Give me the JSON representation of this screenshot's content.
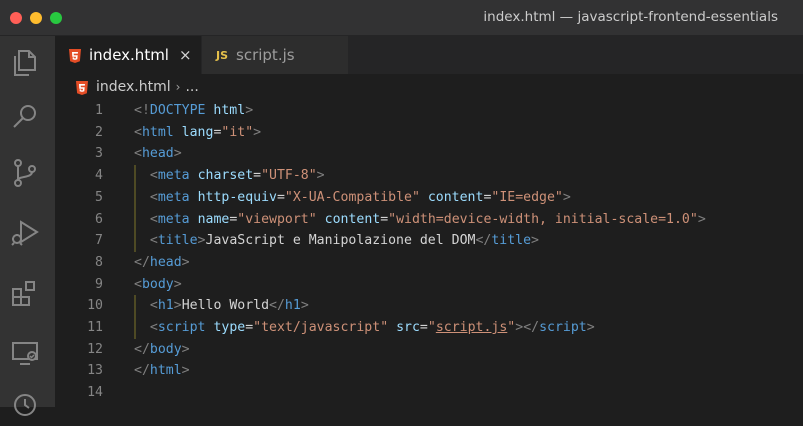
{
  "window": {
    "title": "index.html — javascript-frontend-essentials"
  },
  "activity_bar": {
    "icons": [
      "files-icon",
      "search-icon",
      "source-control-icon",
      "run-debug-icon",
      "extensions-icon",
      "remote-explorer-icon",
      "timeline-icon"
    ]
  },
  "tabs": [
    {
      "label": "index.html",
      "icon": "html5-icon",
      "active": true,
      "close": "×"
    },
    {
      "label": "script.js",
      "icon": "js-icon",
      "badge": "JS",
      "active": false
    }
  ],
  "breadcrumb": {
    "file": "index.html",
    "separator": "›",
    "rest": "..."
  },
  "colors": {
    "tag": "#569cd6",
    "punctuation": "#808080",
    "attribute": "#9cdcfe",
    "string": "#ce9178",
    "text": "#d4d4d4",
    "line_number": "#858585",
    "indent_guide": "#4e4a24"
  },
  "editor": {
    "lines": [
      {
        "n": "1",
        "tokens": [
          [
            "ang",
            "<!"
          ],
          [
            "tag",
            "DOCTYPE"
          ],
          [
            "txt",
            " "
          ],
          [
            "attr",
            "html"
          ],
          [
            "ang",
            ">"
          ]
        ]
      },
      {
        "n": "2",
        "tokens": [
          [
            "ang",
            "<"
          ],
          [
            "tag",
            "html"
          ],
          [
            "txt",
            " "
          ],
          [
            "attr",
            "lang"
          ],
          [
            "txt",
            "="
          ],
          [
            "str",
            "\"it\""
          ],
          [
            "ang",
            ">"
          ]
        ]
      },
      {
        "n": "3",
        "tokens": [
          [
            "ang",
            "<"
          ],
          [
            "tag",
            "head"
          ],
          [
            "ang",
            ">"
          ]
        ]
      },
      {
        "n": "4",
        "tokens": [
          [
            "txt",
            "  "
          ],
          [
            "ang",
            "<"
          ],
          [
            "tag",
            "meta"
          ],
          [
            "txt",
            " "
          ],
          [
            "attr",
            "charset"
          ],
          [
            "txt",
            "="
          ],
          [
            "str",
            "\"UTF-8\""
          ],
          [
            "ang",
            ">"
          ]
        ]
      },
      {
        "n": "5",
        "tokens": [
          [
            "txt",
            "  "
          ],
          [
            "ang",
            "<"
          ],
          [
            "tag",
            "meta"
          ],
          [
            "txt",
            " "
          ],
          [
            "attr",
            "http-equiv"
          ],
          [
            "txt",
            "="
          ],
          [
            "str",
            "\"X-UA-Compatible\""
          ],
          [
            "txt",
            " "
          ],
          [
            "attr",
            "content"
          ],
          [
            "txt",
            "="
          ],
          [
            "str",
            "\"IE=edge\""
          ],
          [
            "ang",
            ">"
          ]
        ]
      },
      {
        "n": "6",
        "tokens": [
          [
            "txt",
            "  "
          ],
          [
            "ang",
            "<"
          ],
          [
            "tag",
            "meta"
          ],
          [
            "txt",
            " "
          ],
          [
            "attr",
            "name"
          ],
          [
            "txt",
            "="
          ],
          [
            "str",
            "\"viewport\""
          ],
          [
            "txt",
            " "
          ],
          [
            "attr",
            "content"
          ],
          [
            "txt",
            "="
          ],
          [
            "str",
            "\"width=device-width, initial-scale=1.0\""
          ],
          [
            "ang",
            ">"
          ]
        ]
      },
      {
        "n": "7",
        "tokens": [
          [
            "txt",
            "  "
          ],
          [
            "ang",
            "<"
          ],
          [
            "tag",
            "title"
          ],
          [
            "ang",
            ">"
          ],
          [
            "txt",
            "JavaScript e Manipolazione del DOM"
          ],
          [
            "ang",
            "</"
          ],
          [
            "tag",
            "title"
          ],
          [
            "ang",
            ">"
          ]
        ]
      },
      {
        "n": "8",
        "tokens": [
          [
            "ang",
            "</"
          ],
          [
            "tag",
            "head"
          ],
          [
            "ang",
            ">"
          ]
        ]
      },
      {
        "n": "9",
        "tokens": [
          [
            "ang",
            "<"
          ],
          [
            "tag",
            "body"
          ],
          [
            "ang",
            ">"
          ]
        ]
      },
      {
        "n": "10",
        "tokens": [
          [
            "txt",
            "  "
          ],
          [
            "ang",
            "<"
          ],
          [
            "tag",
            "h1"
          ],
          [
            "ang",
            ">"
          ],
          [
            "txt",
            "Hello World"
          ],
          [
            "ang",
            "</"
          ],
          [
            "tag",
            "h1"
          ],
          [
            "ang",
            ">"
          ]
        ]
      },
      {
        "n": "11",
        "tokens": [
          [
            "txt",
            "  "
          ],
          [
            "ang",
            "<"
          ],
          [
            "tag",
            "script"
          ],
          [
            "txt",
            " "
          ],
          [
            "attr",
            "type"
          ],
          [
            "txt",
            "="
          ],
          [
            "str",
            "\"text/javascript\""
          ],
          [
            "txt",
            " "
          ],
          [
            "attr",
            "src"
          ],
          [
            "txt",
            "="
          ],
          [
            "str",
            "\""
          ],
          [
            "strlink",
            "script.js"
          ],
          [
            "str",
            "\""
          ],
          [
            "ang",
            "></"
          ],
          [
            "tag",
            "script"
          ],
          [
            "ang",
            ">"
          ]
        ]
      },
      {
        "n": "12",
        "tokens": [
          [
            "ang",
            "</"
          ],
          [
            "tag",
            "body"
          ],
          [
            "ang",
            ">"
          ]
        ]
      },
      {
        "n": "13",
        "tokens": [
          [
            "ang",
            "</"
          ],
          [
            "tag",
            "html"
          ],
          [
            "ang",
            ">"
          ]
        ]
      },
      {
        "n": "14",
        "tokens": []
      }
    ]
  }
}
